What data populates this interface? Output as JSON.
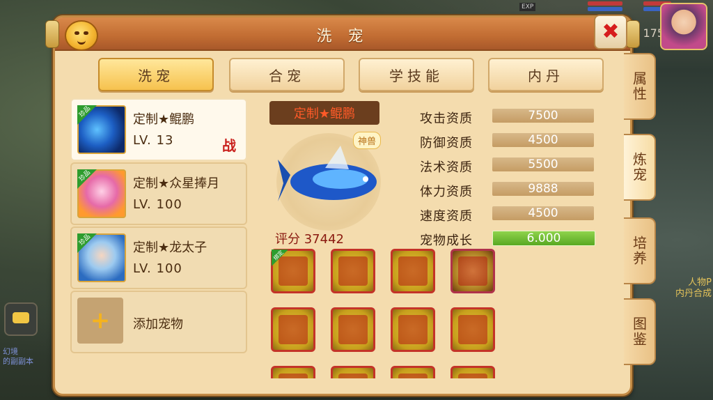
{
  "hud": {
    "exp_label": "EXP",
    "level": "175"
  },
  "side_hint": [
    "人物P",
    "内丹合成"
  ],
  "left_faint": [
    "幻境",
    "的副副本"
  ],
  "dialog": {
    "title": "洗 宠"
  },
  "tabs": [
    {
      "label": "洗宠",
      "active": true
    },
    {
      "label": "合宠"
    },
    {
      "label": "学技能"
    },
    {
      "label": "内丹"
    }
  ],
  "pets": [
    {
      "badge": "珍品",
      "name": "定制★鲲鹏",
      "level": "LV. 13",
      "status": "战"
    },
    {
      "badge": "珍品",
      "name": "定制★众星捧月",
      "level": "LV. 100"
    },
    {
      "badge": "珍品",
      "name": "定制★龙太子",
      "level": "LV. 100"
    }
  ],
  "add_pet": {
    "label": "添加宠物",
    "icon": "plus-icon"
  },
  "detail": {
    "pet_name": "定制★鲲鹏",
    "tag": "神兽",
    "score_label": "评分",
    "score_value": "37442"
  },
  "stats": [
    {
      "label": "攻击资质",
      "value": "7500"
    },
    {
      "label": "防御资质",
      "value": "4500"
    },
    {
      "label": "法术资质",
      "value": "5500"
    },
    {
      "label": "体力资质",
      "value": "9888"
    },
    {
      "label": "速度资质",
      "value": "4500"
    },
    {
      "label": "宠物成长",
      "value": "6.000"
    }
  ],
  "skills": [
    {
      "icon": "shield-skill-icon",
      "bind": "绑定"
    },
    {
      "icon": "spear-skill-icon"
    },
    {
      "icon": "beast-skill-icon"
    },
    {
      "icon": "gold-skill-icon"
    },
    {
      "icon": "flag-skill-icon"
    },
    {
      "icon": "fire-skill-icon"
    },
    {
      "icon": "peach-skill-icon"
    },
    {
      "icon": "strike-skill-icon"
    },
    {
      "icon": "skill-icon-9"
    },
    {
      "icon": "skill-icon-10"
    },
    {
      "icon": "skill-icon-11"
    },
    {
      "icon": "skill-icon-12"
    }
  ],
  "side_tabs": [
    {
      "label": "属性"
    },
    {
      "label": "炼宠",
      "active": true
    },
    {
      "label": "培养"
    },
    {
      "label": "图鉴"
    }
  ]
}
